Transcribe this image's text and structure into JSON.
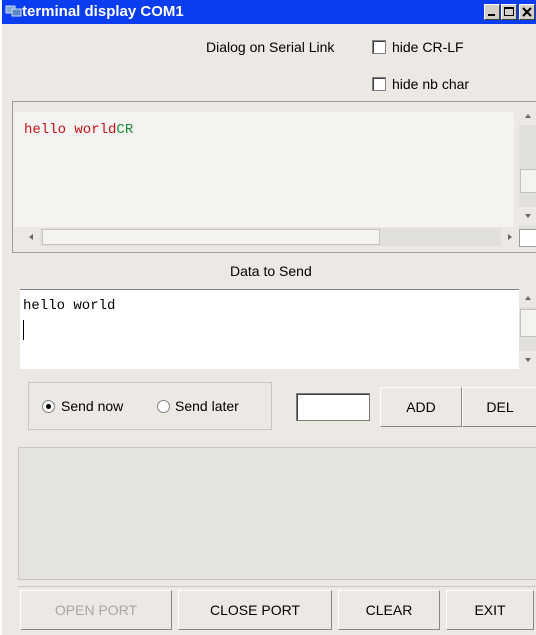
{
  "window": {
    "title": "terminal display  COM1"
  },
  "header": {
    "dialog_label": "Dialog on Serial Link",
    "hide_crlf_label": "hide CR-LF",
    "hide_crlf_checked": false,
    "hide_nb_char_label": "hide nb char",
    "hide_nb_char_checked": false
  },
  "received": {
    "text_main": "hello world",
    "text_suffix": "CR"
  },
  "send": {
    "section_label": "Data to Send",
    "text": "hello world",
    "send_now_label": "Send now",
    "send_later_label": "Send later",
    "selected": "Send now",
    "add_label": "ADD",
    "del_label": "DEL",
    "count_value": ""
  },
  "footer": {
    "open_port_label": "OPEN PORT",
    "close_port_label": "CLOSE PORT",
    "clear_label": "CLEAR",
    "exit_label": "EXIT"
  },
  "colors": {
    "title_bar": "#0a3df0",
    "received_text": "#c8121a",
    "received_suffix": "#1d8a3c"
  }
}
